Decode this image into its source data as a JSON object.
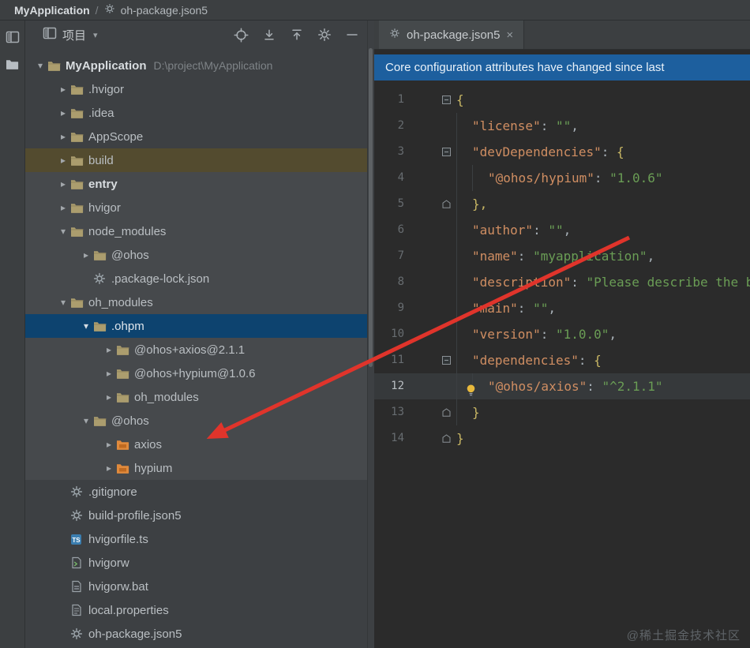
{
  "breadcrumb": {
    "app": "MyApplication",
    "separator": "/",
    "file": "oh-package.json5"
  },
  "stripe": {
    "items": [
      "project-view",
      "folder"
    ]
  },
  "project_panel": {
    "header": {
      "title": "项目",
      "icons": [
        "locate",
        "expand-all",
        "collapse-all",
        "settings",
        "hide"
      ]
    },
    "tree": [
      {
        "label": "MyApplication",
        "suffix": "D:\\project\\MyApplication",
        "level": 0,
        "chevron": "down",
        "icon": "folder",
        "bold": true
      },
      {
        "label": ".hvigor",
        "level": 1,
        "chevron": "right",
        "icon": "folder"
      },
      {
        "label": ".idea",
        "level": 1,
        "chevron": "right",
        "icon": "folder"
      },
      {
        "label": "AppScope",
        "level": 1,
        "chevron": "right",
        "icon": "folder"
      },
      {
        "label": "build",
        "level": 1,
        "chevron": "right",
        "icon": "folder",
        "rowbg": "olive"
      },
      {
        "label": "entry",
        "level": 1,
        "chevron": "right",
        "icon": "folder",
        "bold": true,
        "rowbg": "block"
      },
      {
        "label": "hvigor",
        "level": 1,
        "chevron": "right",
        "icon": "folder",
        "rowbg": "block"
      },
      {
        "label": "node_modules",
        "level": 1,
        "chevron": "down",
        "icon": "folder",
        "rowbg": "block"
      },
      {
        "label": "@ohos",
        "level": 2,
        "chevron": "right",
        "icon": "folder",
        "rowbg": "block"
      },
      {
        "label": ".package-lock.json",
        "level": 2,
        "icon": "json",
        "rowbg": "block"
      },
      {
        "label": "oh_modules",
        "level": 1,
        "chevron": "down",
        "icon": "folder",
        "rowbg": "block"
      },
      {
        "label": ".ohpm",
        "level": 2,
        "chevron": "down",
        "icon": "folder",
        "selected": true
      },
      {
        "label": "@ohos+axios@2.1.1",
        "level": 3,
        "chevron": "right",
        "icon": "folder",
        "rowbg": "block"
      },
      {
        "label": "@ohos+hypium@1.0.6",
        "level": 3,
        "chevron": "right",
        "icon": "folder",
        "rowbg": "block"
      },
      {
        "label": "oh_modules",
        "level": 3,
        "chevron": "right",
        "icon": "folder",
        "rowbg": "block"
      },
      {
        "label": "@ohos",
        "level": 2,
        "chevron": "down",
        "icon": "folder",
        "rowbg": "block"
      },
      {
        "label": "axios",
        "level": 3,
        "chevron": "right",
        "icon": "module",
        "rowbg": "block"
      },
      {
        "label": "hypium",
        "level": 3,
        "chevron": "right",
        "icon": "module",
        "rowbg": "block"
      },
      {
        "label": ".gitignore",
        "level": 1,
        "icon": "json"
      },
      {
        "label": "build-profile.json5",
        "level": 1,
        "icon": "json"
      },
      {
        "label": "hvigorfile.ts",
        "level": 1,
        "icon": "ts"
      },
      {
        "label": "hvigorw",
        "level": 1,
        "icon": "script"
      },
      {
        "label": "hvigorw.bat",
        "level": 1,
        "icon": "bat"
      },
      {
        "label": "local.properties",
        "level": 1,
        "icon": "props"
      },
      {
        "label": "oh-package.json5",
        "level": 1,
        "icon": "json"
      }
    ]
  },
  "editor": {
    "tab": {
      "label": "oh-package.json5",
      "close": "×"
    },
    "banner": {
      "text": "Core configuration attributes have changed since last"
    },
    "code": {
      "lines": [
        {
          "num": "1",
          "fold": "minus",
          "indent": 0,
          "tokens": [
            {
              "c": "brace",
              "v": "{"
            }
          ]
        },
        {
          "num": "2",
          "indent": 1,
          "tokens": [
            {
              "c": "key",
              "v": "\"license\""
            },
            {
              "c": "punc",
              "v": ": "
            },
            {
              "c": "str",
              "v": "\"\""
            },
            {
              "c": "punc",
              "v": ","
            }
          ]
        },
        {
          "num": "3",
          "fold": "minus",
          "indent": 1,
          "tokens": [
            {
              "c": "key",
              "v": "\"devDependencies\""
            },
            {
              "c": "punc",
              "v": ": "
            },
            {
              "c": "brace",
              "v": "{"
            }
          ]
        },
        {
          "num": "4",
          "indent": 2,
          "tokens": [
            {
              "c": "key",
              "v": "\"@ohos/hypium\""
            },
            {
              "c": "punc",
              "v": ": "
            },
            {
              "c": "str",
              "v": "\"1.0.6\""
            }
          ]
        },
        {
          "num": "5",
          "fold": "end",
          "indent": 1,
          "tokens": [
            {
              "c": "brace",
              "v": "},"
            }
          ]
        },
        {
          "num": "6",
          "indent": 1,
          "tokens": [
            {
              "c": "key",
              "v": "\"author\""
            },
            {
              "c": "punc",
              "v": ": "
            },
            {
              "c": "str",
              "v": "\"\""
            },
            {
              "c": "punc",
              "v": ","
            }
          ]
        },
        {
          "num": "7",
          "indent": 1,
          "tokens": [
            {
              "c": "key",
              "v": "\"name\""
            },
            {
              "c": "punc",
              "v": ": "
            },
            {
              "c": "str",
              "v": "\"myapplication\""
            },
            {
              "c": "punc",
              "v": ","
            }
          ]
        },
        {
          "num": "8",
          "indent": 1,
          "tokens": [
            {
              "c": "key",
              "v": "\"description\""
            },
            {
              "c": "punc",
              "v": ": "
            },
            {
              "c": "str",
              "v": "\"Please describe the bas"
            }
          ]
        },
        {
          "num": "9",
          "indent": 1,
          "tokens": [
            {
              "c": "key",
              "v": "\"main\""
            },
            {
              "c": "punc",
              "v": ": "
            },
            {
              "c": "str",
              "v": "\"\""
            },
            {
              "c": "punc",
              "v": ","
            }
          ]
        },
        {
          "num": "10",
          "indent": 1,
          "tokens": [
            {
              "c": "key",
              "v": "\"version\""
            },
            {
              "c": "punc",
              "v": ": "
            },
            {
              "c": "str",
              "v": "\"1.0.0\""
            },
            {
              "c": "punc",
              "v": ","
            }
          ]
        },
        {
          "num": "11",
          "fold": "minus",
          "indent": 1,
          "tokens": [
            {
              "c": "key",
              "v": "\"dependencies\""
            },
            {
              "c": "punc",
              "v": ": "
            },
            {
              "c": "brace",
              "v": "{"
            }
          ]
        },
        {
          "num": "12",
          "indent": 2,
          "current": true,
          "bulb": true,
          "tokens": [
            {
              "c": "key",
              "v": "\"@ohos/axios\""
            },
            {
              "c": "punc",
              "v": ": "
            },
            {
              "c": "str",
              "v": "\"^2.1.1\""
            }
          ]
        },
        {
          "num": "13",
          "fold": "end",
          "indent": 1,
          "tokens": [
            {
              "c": "brace",
              "v": "}"
            }
          ]
        },
        {
          "num": "14",
          "fold": "end",
          "indent": 0,
          "tokens": [
            {
              "c": "brace",
              "v": "}"
            }
          ]
        }
      ]
    }
  },
  "watermark": "@稀土掘金技术社区",
  "colors": {
    "selection_blue": "#0d436f",
    "excluded_olive": "#534b2f",
    "banner_blue": "#1d5f9e",
    "arrow_red": "#e0342b"
  }
}
